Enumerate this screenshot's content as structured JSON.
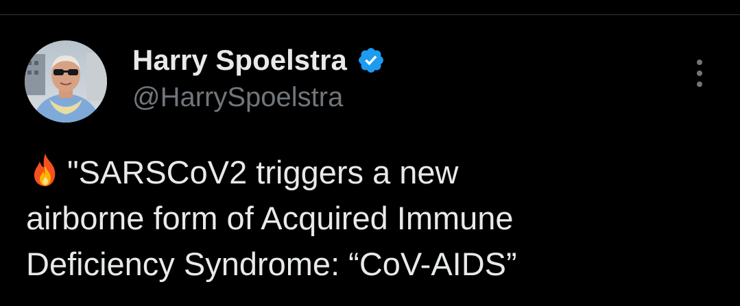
{
  "tweet": {
    "author": {
      "display_name": "Harry Spoelstra",
      "handle": "@HarrySpoelstra",
      "verified_icon": "verified-badge-icon",
      "avatar_icon": "user-avatar"
    },
    "more_icon": "more-vertical-icon",
    "text": {
      "emoji_icon": "fire-icon",
      "line1": "\"SARSCoV2 triggers a new",
      "line2": "airborne form of Acquired Immune",
      "line3": "Deficiency Syndrome: “CoV-AIDS”"
    }
  },
  "colors": {
    "background": "#000000",
    "primary_text": "#e7e9ea",
    "secondary_text": "#71767b",
    "verified_blue": "#1d9bf0",
    "divider": "#2f3336"
  }
}
